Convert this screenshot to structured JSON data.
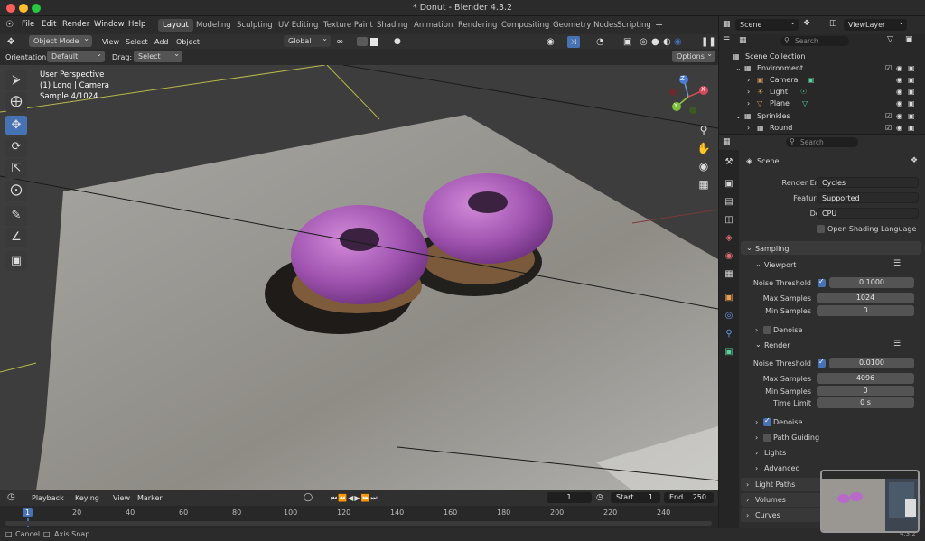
{
  "window": {
    "title": "* Donut - Blender 4.3.2"
  },
  "menu": [
    "File",
    "Edit",
    "Render",
    "Window",
    "Help"
  ],
  "workspaces": [
    "Layout",
    "Modeling",
    "Sculpting",
    "UV Editing",
    "Texture Paint",
    "Shading",
    "Animation",
    "Rendering",
    "Compositing",
    "Geometry Nodes",
    "Scripting"
  ],
  "active_workspace": "Layout",
  "add_workspace": "+",
  "scene_selector": {
    "label": "Scene",
    "viewlayer": "ViewLayer"
  },
  "header3d": {
    "mode": "Object Mode",
    "view": "View",
    "select": "Select",
    "add": "Add",
    "object": "Object",
    "transform": "Global"
  },
  "tool_options": {
    "orientation_label": "Orientation:",
    "orientation": "Default",
    "drag_label": "Drag:",
    "drag": "Select Box",
    "options": "Options"
  },
  "viewport_info": {
    "line1": "User Perspective",
    "line2": "(1) Long | Camera",
    "line3": "Sample 4/1024"
  },
  "gizmo_axes": {
    "x": "X",
    "y": "Y",
    "z": "Z"
  },
  "timeline": {
    "playback": "Playback",
    "keying": "Keying",
    "view": "View",
    "marker": "Marker",
    "current_frame": "1",
    "start_label": "Start",
    "start": "1",
    "end_label": "End",
    "end": "250",
    "ticks": [
      "1",
      "20",
      "40",
      "60",
      "80",
      "100",
      "120",
      "140",
      "160",
      "180",
      "200",
      "220",
      "240"
    ]
  },
  "status": {
    "cancel": "Cancel",
    "axis_snap": "Axis Snap",
    "version": "4.3.2"
  },
  "outliner": {
    "search_placeholder": "Search",
    "items": [
      {
        "label": "Scene Collection",
        "indent": 0
      },
      {
        "label": "Environment",
        "indent": 1
      },
      {
        "label": "Camera",
        "indent": 2
      },
      {
        "label": "Light",
        "indent": 2
      },
      {
        "label": "Plane",
        "indent": 2
      },
      {
        "label": "Sprinkles",
        "indent": 1
      },
      {
        "label": "Round",
        "indent": 2
      }
    ]
  },
  "properties": {
    "search_placeholder": "Search",
    "context": "Scene",
    "render_engine_label": "Render Engine",
    "render_engine": "Cycles",
    "feature_set_label": "Feature Set",
    "feature_set": "Supported",
    "device_label": "Device",
    "device": "CPU",
    "osl_label": "Open Shading Language",
    "sampling": "Sampling",
    "viewport": "Viewport",
    "vp_noise_label": "Noise Threshold",
    "vp_noise": "0.1000",
    "vp_max_label": "Max Samples",
    "vp_max": "1024",
    "vp_min_label": "Min Samples",
    "vp_min": "0",
    "vp_denoise": "Denoise",
    "render": "Render",
    "r_noise_label": "Noise Threshold",
    "r_noise": "0.0100",
    "r_max_label": "Max Samples",
    "r_max": "4096",
    "r_min_label": "Min Samples",
    "r_min": "0",
    "r_time_label": "Time Limit",
    "r_time": "0 s",
    "r_denoise": "Denoise",
    "path_guiding": "Path Guiding",
    "lights": "Lights",
    "advanced": "Advanced",
    "light_paths": "Light Paths",
    "volumes": "Volumes",
    "curves": "Curves"
  },
  "colors": {
    "accent": "#4772b3",
    "bg": "#303030",
    "panel": "#2e2e2e"
  }
}
